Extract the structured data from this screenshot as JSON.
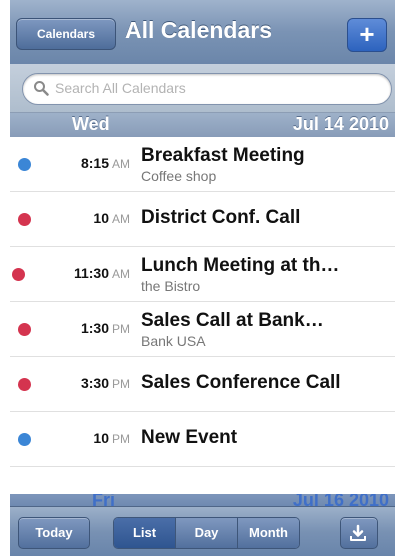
{
  "header": {
    "back_label": "Calendars",
    "title": "All Calendars",
    "add_label": "+"
  },
  "search": {
    "placeholder": "Search All Calendars"
  },
  "day_header": {
    "day": "Wed",
    "date": "Jul 14 2010"
  },
  "events": [
    {
      "time": "8:15",
      "ampm": "AM",
      "title": "Breakfast Meeting",
      "subtitle": "Coffee shop",
      "color": "#3b86d6"
    },
    {
      "time": "10",
      "ampm": "AM",
      "title": "District Conf. Call",
      "subtitle": "",
      "color": "#d4344f"
    },
    {
      "time": "11:30",
      "ampm": "AM",
      "title": "Lunch Meeting at th…",
      "subtitle": "the Bistro",
      "color": "#d4344f"
    },
    {
      "time": "1:30",
      "ampm": "PM",
      "title": "Sales Call at Bank…",
      "subtitle": "Bank USA",
      "color": "#d4344f"
    },
    {
      "time": "3:30",
      "ampm": "PM",
      "title": "Sales Conference Call",
      "subtitle": "",
      "color": "#d4344f"
    },
    {
      "time": "10",
      "ampm": "PM",
      "title": "New Event",
      "subtitle": "",
      "color": "#3b86d6"
    }
  ],
  "next_day_header": {
    "day": "Fri",
    "date": "Jul 16 2010"
  },
  "toolbar": {
    "today_label": "Today",
    "segments": [
      "List",
      "Day",
      "Month"
    ],
    "active_segment": "List",
    "download_icon": "download-icon"
  }
}
